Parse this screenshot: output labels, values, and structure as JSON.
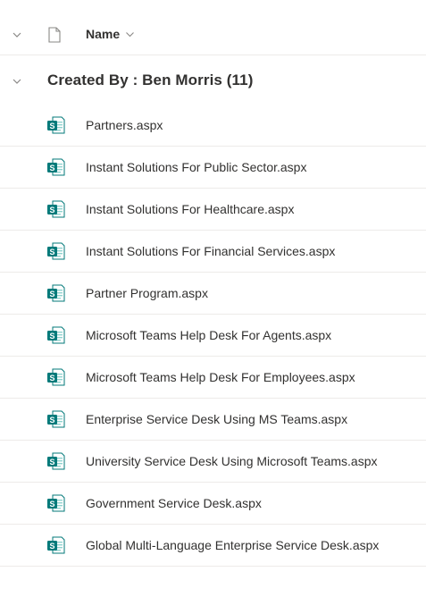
{
  "header": {
    "name_label": "Name"
  },
  "group": {
    "title": "Created By : Ben Morris (11)"
  },
  "files": [
    {
      "name": "Partners.aspx",
      "icon": "sharepoint-page-icon"
    },
    {
      "name": "Instant Solutions For Public Sector.aspx",
      "icon": "sharepoint-page-icon"
    },
    {
      "name": "Instant Solutions For Healthcare.aspx",
      "icon": "sharepoint-page-icon"
    },
    {
      "name": "Instant Solutions For Financial Services.aspx",
      "icon": "sharepoint-page-icon"
    },
    {
      "name": "Partner Program.aspx",
      "icon": "sharepoint-page-icon"
    },
    {
      "name": "Microsoft Teams Help Desk For Agents.aspx",
      "icon": "sharepoint-page-icon"
    },
    {
      "name": "Microsoft Teams Help Desk For Employees.aspx",
      "icon": "sharepoint-page-icon"
    },
    {
      "name": "Enterprise Service Desk Using MS Teams.aspx",
      "icon": "sharepoint-page-icon"
    },
    {
      "name": "University Service Desk Using Microsoft Teams.aspx",
      "icon": "sharepoint-page-icon"
    },
    {
      "name": "Government Service Desk.aspx",
      "icon": "sharepoint-page-icon"
    },
    {
      "name": "Global Multi-Language Enterprise Service Desk.aspx",
      "icon": "sharepoint-page-icon"
    }
  ],
  "colors": {
    "icon_teal": "#037a7a",
    "icon_light": "#8fd3cf",
    "text": "#323130",
    "divider": "#edebe9"
  }
}
